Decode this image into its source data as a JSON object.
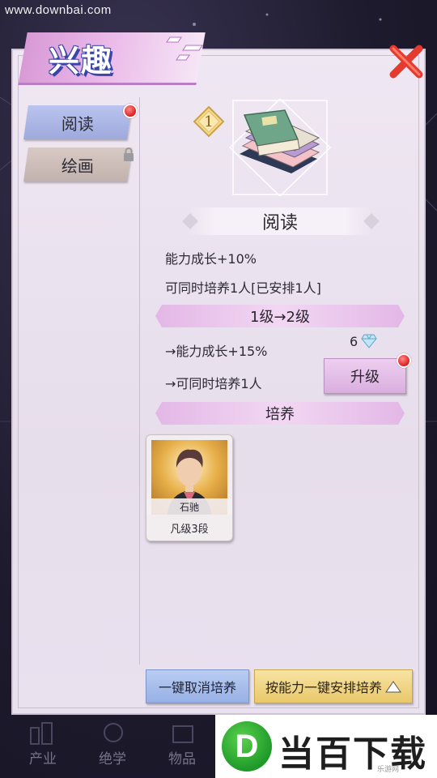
{
  "watermark": "www.downbai.com",
  "header": {
    "title": "兴趣"
  },
  "sidebar": {
    "items": [
      {
        "label": "阅读",
        "active": true,
        "has_notification": true
      },
      {
        "label": "绘画",
        "active": false,
        "locked": true
      }
    ]
  },
  "detail": {
    "level": "1",
    "name": "阅读",
    "stat_growth": "能力成长+10%",
    "stat_capacity": "可同时培养1人[已安排1人]",
    "upgrade_header": "1级→2级",
    "next_growth": "→能力成长+15%",
    "next_capacity": "→可同时培养1人",
    "upgrade_cost": "6",
    "upgrade_button": "升级",
    "train_header": "培养"
  },
  "characters": [
    {
      "name": "石驰",
      "rank": "凡级3段"
    }
  ],
  "footer": {
    "cancel_button": "一键取消培养",
    "arrange_button": "按能力一键安排培养"
  },
  "bottom_nav": {
    "items": [
      "产业",
      "绝学",
      "物品"
    ]
  },
  "logo": {
    "text": "当百下载",
    "letter": "D",
    "sub": "乐游网"
  },
  "colors": {
    "accent_pink": "#e3b7e6",
    "tab_active": "#b9c4ef",
    "tab_inactive": "#d7c9c4",
    "cancel_blue": "#b9cdf3",
    "arrange_gold": "#f0d68a",
    "notification_red": "#e01c1c"
  },
  "icons": {
    "close": "close-icon",
    "book": "book-stack-icon",
    "diamond": "diamond-icon",
    "lock": "lock-icon",
    "triangle": "triangle-up-icon"
  }
}
